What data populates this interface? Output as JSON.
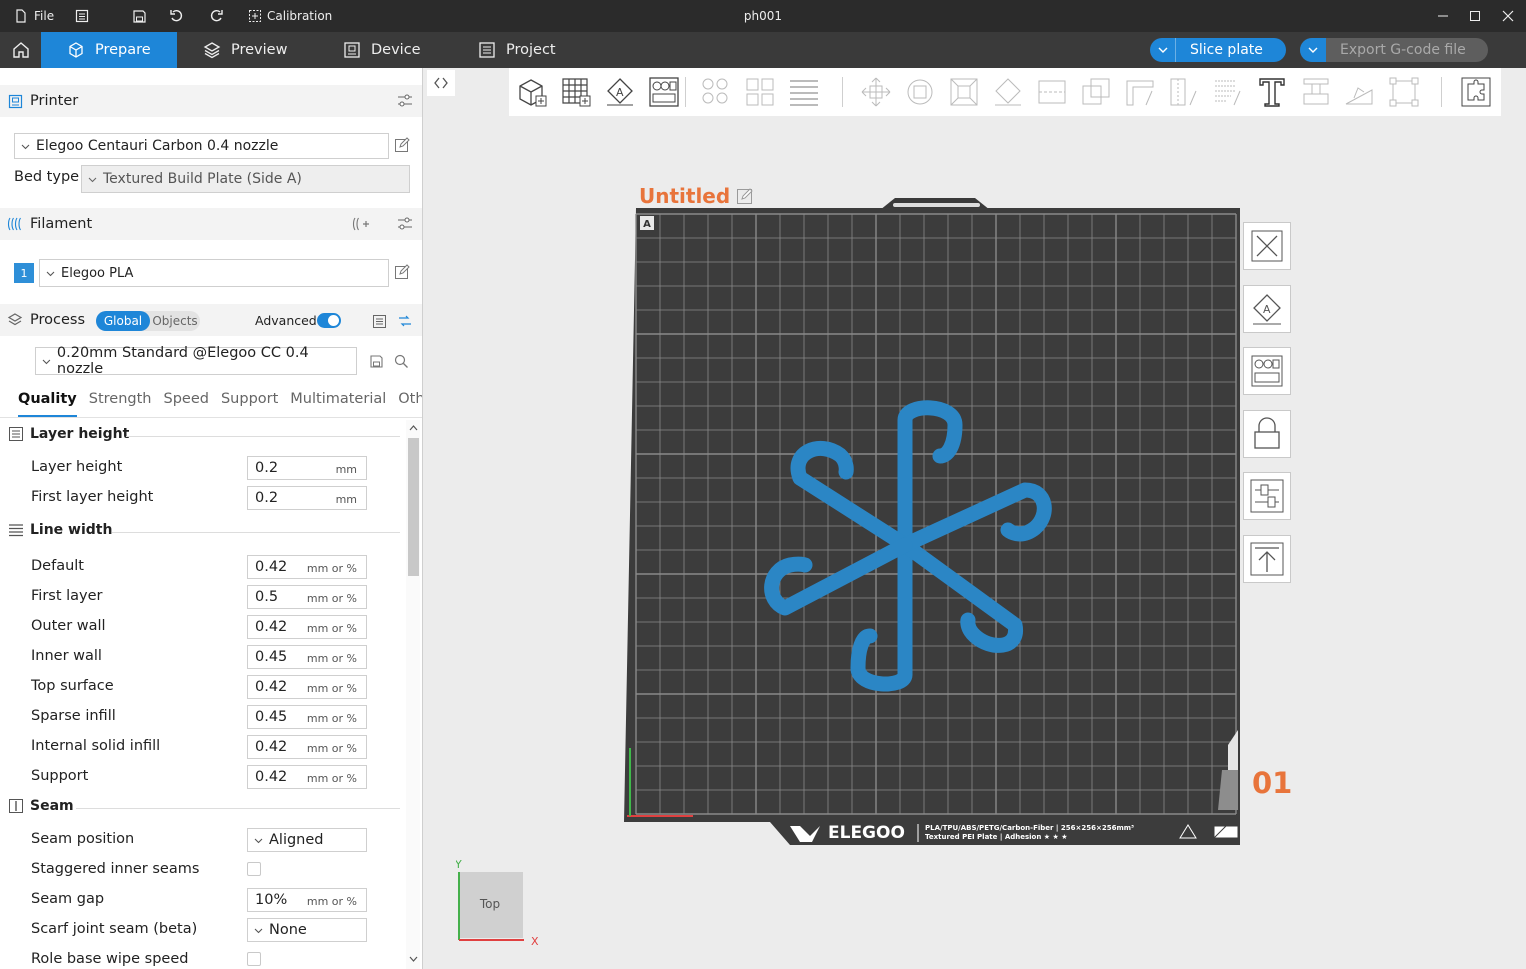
{
  "titlebar": {
    "file_label": "File",
    "calibration_label": "Calibration",
    "project_name": "ph001"
  },
  "nav": {
    "tabs": [
      "Prepare",
      "Preview",
      "Device",
      "Project"
    ],
    "active_tab": "Prepare",
    "slice_label": "Slice plate",
    "export_label": "Export G-code file"
  },
  "printer": {
    "section_label": "Printer",
    "printer_name": "Elegoo Centauri Carbon 0.4 nozzle",
    "bed_type_label": "Bed type",
    "bed_type_value": "Textured Build Plate (Side A)"
  },
  "filament": {
    "section_label": "Filament",
    "slot_number": "1",
    "slot_color": "#2e8fd8",
    "name": "Elegoo PLA"
  },
  "process": {
    "section_label": "Process",
    "scope_global": "Global",
    "scope_objects": "Objects",
    "advanced_label": "Advanced",
    "preset": "0.20mm Standard @Elegoo CC 0.4 nozzle",
    "tabs": [
      "Quality",
      "Strength",
      "Speed",
      "Support",
      "Multimaterial",
      "Oth..."
    ],
    "active_tab": "Quality"
  },
  "quality": {
    "layer_height_group": "Layer height",
    "layer_height_rows": [
      {
        "label": "Layer height",
        "value": "0.2",
        "unit": "mm"
      },
      {
        "label": "First layer height",
        "value": "0.2",
        "unit": "mm"
      }
    ],
    "line_width_group": "Line width",
    "line_width_rows": [
      {
        "label": "Default",
        "value": "0.42",
        "unit": "mm or %"
      },
      {
        "label": "First layer",
        "value": "0.5",
        "unit": "mm or %"
      },
      {
        "label": "Outer wall",
        "value": "0.42",
        "unit": "mm or %"
      },
      {
        "label": "Inner wall",
        "value": "0.45",
        "unit": "mm or %"
      },
      {
        "label": "Top surface",
        "value": "0.42",
        "unit": "mm or %"
      },
      {
        "label": "Sparse infill",
        "value": "0.45",
        "unit": "mm or %"
      },
      {
        "label": "Internal solid infill",
        "value": "0.42",
        "unit": "mm or %"
      },
      {
        "label": "Support",
        "value": "0.42",
        "unit": "mm or %"
      }
    ],
    "seam_group": "Seam",
    "seam_position_label": "Seam position",
    "seam_position_value": "Aligned",
    "staggered_label": "Staggered inner seams",
    "seam_gap_label": "Seam gap",
    "seam_gap_value": "10%",
    "seam_gap_unit": "mm or %",
    "scarf_label": "Scarf joint seam (beta)",
    "scarf_value": "None",
    "role_wipe_label": "Role base wipe speed"
  },
  "canvas": {
    "plate_name": "Untitled",
    "plate_number": "01",
    "plate_badge": "A",
    "brand": "ELEGOO",
    "plate_info_line1": "PLA/TPU/ABS/PETG/Carbon-Fiber | 256×256×256mm³",
    "plate_info_line2": "Textured PEI Plate | Adhesion ★ ★ ★",
    "model_color": "#2b86c5",
    "accent_color": "#e8743b",
    "axis_y": "Y",
    "axis_x": "X",
    "view_label": "Top"
  }
}
